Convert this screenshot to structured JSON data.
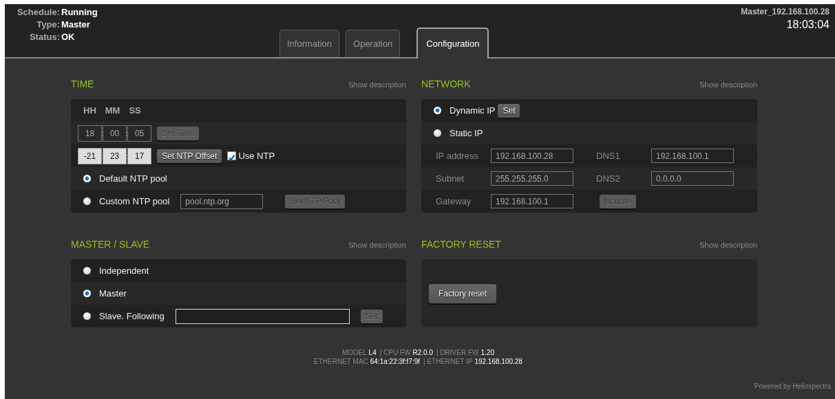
{
  "header": {
    "status": [
      {
        "label": "Schedule:",
        "value": "Running"
      },
      {
        "label": "Type:",
        "value": "Master"
      },
      {
        "label": "Status:",
        "value": "OK"
      }
    ],
    "device_name": "Master_192.168.100.28",
    "clock": "18:03:04"
  },
  "tabs": [
    {
      "label": "Information",
      "selected": false
    },
    {
      "label": "Operation",
      "selected": false
    },
    {
      "label": "Configuration",
      "selected": true
    }
  ],
  "time": {
    "title": "TIME",
    "show_description": "Show description",
    "columns": [
      "HH",
      "MM",
      "SS"
    ],
    "clock_fields": {
      "values": [
        "18",
        "00",
        "05"
      ],
      "separators": [
        ":",
        ":"
      ],
      "disabled": true
    },
    "set_time_button": {
      "label": "Set Time",
      "disabled": true
    },
    "offset_fields": {
      "values": [
        "-21",
        "23",
        "17"
      ],
      "separators": [
        ":",
        ":"
      ],
      "disabled": false
    },
    "set_offset_button": {
      "label": "Set NTP Offset",
      "disabled": false
    },
    "use_ntp": {
      "label": "Use NTP",
      "checked": true
    },
    "pools": [
      {
        "kind": "plain",
        "label": "Default NTP pool",
        "selected": true
      },
      {
        "kind": "field",
        "label": "Custom NTP pool",
        "selected": false,
        "field": {
          "value": "pool.ntp.org",
          "disabled": true
        },
        "button": {
          "label": "Set NTP Pool",
          "disabled": true
        }
      }
    ]
  },
  "network": {
    "title": "NETWORK",
    "show_description": "Show description",
    "modes": [
      {
        "kind": "button",
        "label": "Dynamic IP",
        "selected": true,
        "button": {
          "label": "Set",
          "disabled": false
        }
      },
      {
        "kind": "plain",
        "label": "Static IP",
        "selected": false
      }
    ],
    "fields_disabled": true,
    "rows": [
      {
        "kind": "pair",
        "label": "IP address",
        "value": "192.168.100.28",
        "label_2": "DNS1",
        "value_2": "192.168.100.1"
      },
      {
        "kind": "pair",
        "label": "Subnet",
        "value": "255.255.255.0",
        "label_2": "DNS2",
        "value_2": "0.0.0.0"
      },
      {
        "kind": "button",
        "label": "Gateway",
        "value": "192.168.100.1",
        "button": {
          "label": "Update",
          "disabled": true
        }
      }
    ]
  },
  "master_slave": {
    "title": "MASTER / SLAVE",
    "show_description": "Show description",
    "options": [
      {
        "kind": "plain",
        "label": "Independent",
        "selected": false
      },
      {
        "kind": "plain",
        "label": "Master",
        "selected": true
      },
      {
        "kind": "field",
        "label": "Slave. Following",
        "selected": false,
        "field": {
          "disabled": false
        },
        "button": {
          "label": "Set",
          "disabled": true
        }
      }
    ]
  },
  "factory_reset": {
    "title": "FACTORY RESET",
    "show_description": "Show description",
    "button": {
      "label": "Factory reset",
      "disabled": false
    }
  },
  "footer": {
    "lines": [
      [
        {
          "label": "MODEL",
          "value": "L4"
        },
        {
          "label": "| CPU FW",
          "value": "R2.0.0"
        },
        {
          "label": "| DRIVER FW",
          "value": "1.20"
        }
      ],
      [
        {
          "label": "ETHERNET MAC",
          "value": "64:1a:22:3f:f7:9f"
        },
        {
          "label": "| ETHERNET IP",
          "value": "192.168.100.28"
        }
      ]
    ],
    "powered_by": "Powered by Heliospectra"
  }
}
